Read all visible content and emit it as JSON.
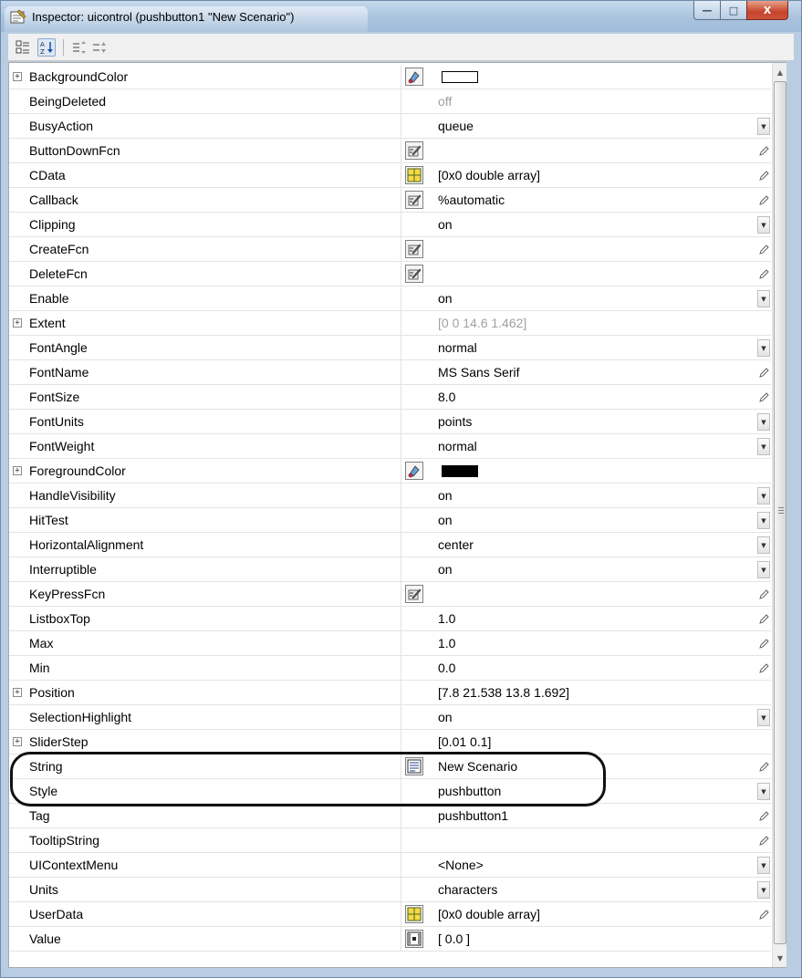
{
  "window": {
    "title": "Inspector:  uicontrol (pushbutton1 \"New Scenario\")",
    "controls": {
      "minimize": "—",
      "maximize": "□",
      "close": "X"
    }
  },
  "toolbar": {
    "buttons": [
      {
        "icon": "categorized-view-icon",
        "active": false
      },
      {
        "icon": "alphabetical-sort-icon",
        "active": true
      },
      {
        "icon": "expand-all-icon",
        "active": false
      },
      {
        "icon": "collapse-all-icon",
        "active": false
      }
    ]
  },
  "colors": {
    "title_bar": "#a9c3df",
    "close_button": "#c4452b",
    "disabled_text": "#a0a0a0",
    "highlight_outline": "#111111",
    "background_color_swatch": "#ffffff",
    "foreground_color_swatch": "#000000"
  },
  "properties": [
    {
      "name": "BackgroundColor",
      "expandable": true,
      "value": "",
      "swatch": "#ffffff",
      "editor": "color-picker-icon",
      "control": "none"
    },
    {
      "name": "BeingDeleted",
      "expandable": false,
      "value": "off",
      "disabled": true,
      "control": "none"
    },
    {
      "name": "BusyAction",
      "expandable": false,
      "value": "queue",
      "control": "dropdown"
    },
    {
      "name": "ButtonDownFcn",
      "expandable": false,
      "value": "",
      "editor": "callback-editor-icon",
      "control": "pencil"
    },
    {
      "name": "CData",
      "expandable": false,
      "value": "[0x0  double array]",
      "editor": "array-editor-icon",
      "control": "pencil"
    },
    {
      "name": "Callback",
      "expandable": false,
      "value": "%automatic",
      "editor": "callback-editor-icon",
      "control": "pencil"
    },
    {
      "name": "Clipping",
      "expandable": false,
      "value": "on",
      "control": "dropdown"
    },
    {
      "name": "CreateFcn",
      "expandable": false,
      "value": "",
      "editor": "callback-editor-icon",
      "control": "pencil"
    },
    {
      "name": "DeleteFcn",
      "expandable": false,
      "value": "",
      "editor": "callback-editor-icon",
      "control": "pencil"
    },
    {
      "name": "Enable",
      "expandable": false,
      "value": "on",
      "control": "dropdown"
    },
    {
      "name": "Extent",
      "expandable": true,
      "value": "[0 0 14.6 1.462]",
      "disabled": true,
      "control": "none"
    },
    {
      "name": "FontAngle",
      "expandable": false,
      "value": "normal",
      "control": "dropdown"
    },
    {
      "name": "FontName",
      "expandable": false,
      "value": "MS Sans Serif",
      "control": "pencil"
    },
    {
      "name": "FontSize",
      "expandable": false,
      "value": "8.0",
      "control": "pencil"
    },
    {
      "name": "FontUnits",
      "expandable": false,
      "value": "points",
      "control": "dropdown"
    },
    {
      "name": "FontWeight",
      "expandable": false,
      "value": "normal",
      "control": "dropdown"
    },
    {
      "name": "ForegroundColor",
      "expandable": true,
      "value": "",
      "swatch": "#000000",
      "editor": "color-picker-icon",
      "control": "none"
    },
    {
      "name": "HandleVisibility",
      "expandable": false,
      "value": "on",
      "control": "dropdown"
    },
    {
      "name": "HitTest",
      "expandable": false,
      "value": "on",
      "control": "dropdown"
    },
    {
      "name": "HorizontalAlignment",
      "expandable": false,
      "value": "center",
      "control": "dropdown"
    },
    {
      "name": "Interruptible",
      "expandable": false,
      "value": "on",
      "control": "dropdown"
    },
    {
      "name": "KeyPressFcn",
      "expandable": false,
      "value": "",
      "editor": "callback-editor-icon",
      "control": "pencil"
    },
    {
      "name": "ListboxTop",
      "expandable": false,
      "value": "1.0",
      "control": "pencil"
    },
    {
      "name": "Max",
      "expandable": false,
      "value": "1.0",
      "control": "pencil"
    },
    {
      "name": "Min",
      "expandable": false,
      "value": "0.0",
      "control": "pencil"
    },
    {
      "name": "Position",
      "expandable": true,
      "value": "[7.8 21.538 13.8 1.692]",
      "control": "none"
    },
    {
      "name": "SelectionHighlight",
      "expandable": false,
      "value": "on",
      "control": "dropdown"
    },
    {
      "name": "SliderStep",
      "expandable": true,
      "value": "[0.01 0.1]",
      "control": "none"
    },
    {
      "name": "String",
      "expandable": false,
      "value": "New Scenario",
      "editor": "string-editor-icon",
      "control": "pencil",
      "highlighted": true
    },
    {
      "name": "Style",
      "expandable": false,
      "value": "pushbutton",
      "control": "dropdown"
    },
    {
      "name": "Tag",
      "expandable": false,
      "value": "pushbutton1",
      "control": "pencil"
    },
    {
      "name": "TooltipString",
      "expandable": false,
      "value": "",
      "control": "pencil"
    },
    {
      "name": "UIContextMenu",
      "expandable": false,
      "value": "<None>",
      "control": "dropdown"
    },
    {
      "name": "Units",
      "expandable": false,
      "value": "characters",
      "control": "dropdown"
    },
    {
      "name": "UserData",
      "expandable": false,
      "value": "[0x0  double array]",
      "editor": "array-editor-icon",
      "control": "pencil"
    },
    {
      "name": "Value",
      "expandable": false,
      "value": "[ 0.0 ]",
      "editor": "matrix-editor-icon",
      "control": "none"
    }
  ]
}
